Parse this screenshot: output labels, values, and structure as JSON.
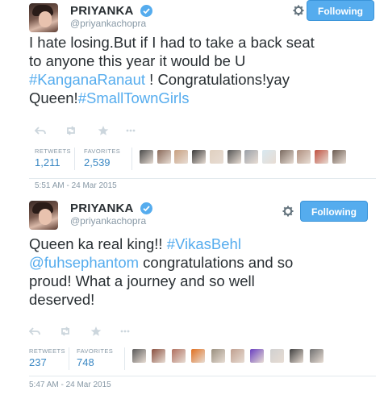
{
  "tweets": [
    {
      "name": "PRIYANKA",
      "handle": "@priyankachopra",
      "follow_label": "Following",
      "text": [
        {
          "t": "I hate losing.But if I had to take a back seat",
          "tag": false
        },
        {
          "br": true
        },
        {
          "t": "to anyone this year it would be U",
          "tag": false
        },
        {
          "br": true
        },
        {
          "t": "#KanganaRanaut",
          "tag": true
        },
        {
          "t": " ! Congratulations!yay",
          "tag": false
        },
        {
          "br": true
        },
        {
          "t": "Queen!",
          "tag": false
        },
        {
          "t": "#SmallTownGirls",
          "tag": true
        }
      ],
      "retweets_label": "RETWEETS",
      "retweets": "1,211",
      "favorites_label": "FAVORITES",
      "favorites": "2,539",
      "timestamp": "5:51 AM - 24 Mar 2015",
      "favoriters": [
        "#4a4a4a",
        "#8a6a5a",
        "#c8a080",
        "#3a3a3a",
        "#e0d0c0",
        "#555555",
        "#9aa0a8",
        "#d8e8f0",
        "#7a6a60",
        "#b09080",
        "#c05040",
        "#6a5a50"
      ]
    },
    {
      "name": "PRIYANKA",
      "handle": "@priyankachopra",
      "follow_label": "Following",
      "text": [
        {
          "t": "Queen ka real king!! ",
          "tag": false
        },
        {
          "t": "#VikasBehl",
          "tag": true
        },
        {
          "br": true
        },
        {
          "t": "@fuhsephantom",
          "tag": true
        },
        {
          "t": " congratulations and so",
          "tag": false
        },
        {
          "br": true
        },
        {
          "t": "proud! What a journey and so well",
          "tag": false
        },
        {
          "br": true
        },
        {
          "t": "deserved!",
          "tag": false
        }
      ],
      "retweets_label": "RETWEETS",
      "retweets": "237",
      "favorites_label": "FAVORITES",
      "favorites": "748",
      "timestamp": "5:47 AM - 24 Mar 2015",
      "favoriters": [
        "#5a5a5a",
        "#8a5040",
        "#b07060",
        "#e07020",
        "#9a9080",
        "#c0a090",
        "#6a40c0",
        "#d0d0d0",
        "#404040",
        "#707070"
      ]
    }
  ],
  "colors": {
    "accent": "#55acee",
    "link": "#3b88c3",
    "muted": "#8899a6",
    "text": "#292f33"
  },
  "icons": {
    "verified": "verified-badge-icon",
    "gear": "gear-icon",
    "reply": "reply-icon",
    "retweet": "retweet-icon",
    "favorite": "star-icon",
    "more": "more-icon"
  }
}
